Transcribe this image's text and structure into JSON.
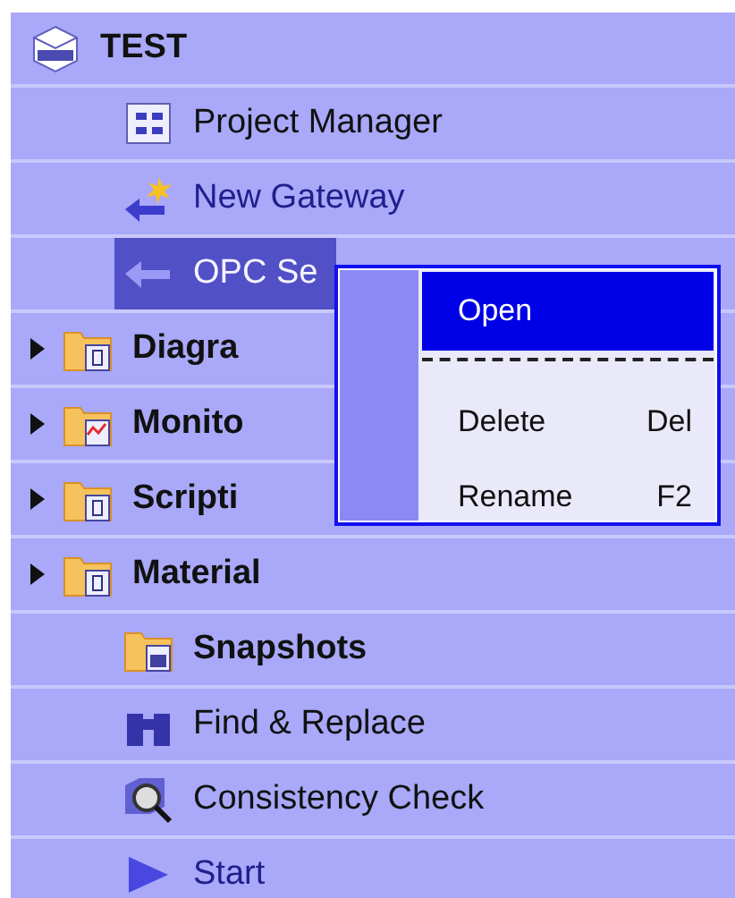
{
  "tree": {
    "root": {
      "label": "TEST"
    },
    "items": [
      {
        "kind": "tool",
        "label": "Project Manager",
        "selected": false
      },
      {
        "kind": "link",
        "label": "New Gateway",
        "selected": false
      },
      {
        "kind": "tool",
        "label": "OPC Se",
        "selected": true
      },
      {
        "kind": "folder",
        "label": "Diagra",
        "selected": false,
        "expandable": true
      },
      {
        "kind": "folder",
        "label": "Monito",
        "selected": false,
        "expandable": true
      },
      {
        "kind": "folder",
        "label": "Scripti",
        "selected": false,
        "expandable": true
      },
      {
        "kind": "folder",
        "label": "Material",
        "selected": false,
        "expandable": true
      },
      {
        "kind": "folder",
        "label": "Snapshots",
        "selected": false,
        "expandable": false
      },
      {
        "kind": "tool",
        "label": "Find & Replace",
        "selected": false
      },
      {
        "kind": "tool",
        "label": "Consistency Check",
        "selected": false
      },
      {
        "kind": "link",
        "label": "Start",
        "selected": false
      }
    ]
  },
  "context_menu": {
    "items": [
      {
        "kind": "item",
        "label": "Open",
        "selected": true
      },
      {
        "kind": "separator"
      },
      {
        "kind": "item",
        "label": "Delete",
        "shortcut": "Del",
        "selected": false
      },
      {
        "kind": "item",
        "label": "Rename",
        "shortcut": "F2",
        "selected": false
      }
    ]
  }
}
